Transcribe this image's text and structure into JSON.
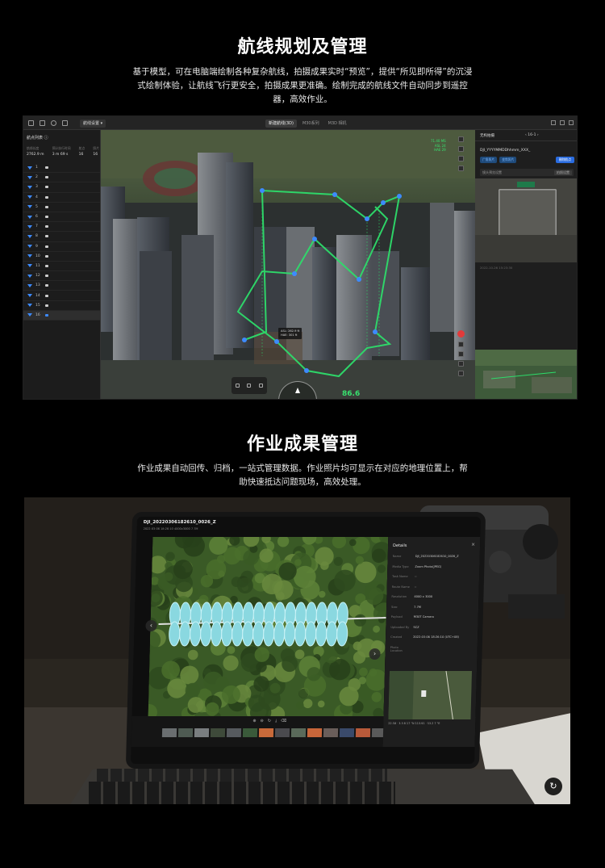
{
  "section1": {
    "title": "航线规划及管理",
    "desc_line1": "基于模型，可在电脑端绘制各种复杂航线，拍摄成果实时“预览”，提供“所见即所得”的沉浸",
    "desc_line2": "式绘制体验，让航线飞行更安全，拍摄成果更准确。绘制完成的航线文件自动同步到遥控",
    "desc_line3": "器，高效作业。"
  },
  "app": {
    "topbar": {
      "dropdown": "航线设置",
      "tabs": [
        "新建航线(3D)",
        "M30系列",
        "M3D 相机"
      ]
    },
    "left": {
      "title": "航点列表",
      "stats": [
        {
          "key": "航线长度",
          "value": "2762.9 m"
        },
        {
          "key": "预计执行时间",
          "value": "3 m 69 s"
        },
        {
          "key": "航点",
          "value": "16"
        },
        {
          "key": "照片",
          "value": "16"
        }
      ],
      "waypoints": [
        "1",
        "2",
        "3",
        "4",
        "5",
        "6",
        "7",
        "8",
        "9",
        "10",
        "11",
        "12",
        "13",
        "14",
        "15",
        "16"
      ]
    },
    "hud": {
      "alt_line1": "71.40 MS",
      "alt_line2": "ASL 24",
      "alt_line3": "HAE 29",
      "bottom_value": "86.6",
      "tooltip_line1": "ASL: 262.9 ft",
      "tooltip_line2": "HAE: 301 ft"
    },
    "right": {
      "header_left": "无构拍摄",
      "header_right": "16-1",
      "file": "DJI_YYYYMMDDhhmm_XXX_",
      "tags": [
        "广角照片",
        "变焦照片"
      ],
      "tag_button": "删除航点",
      "row_label": "镜头预览设置",
      "row_button": "拍照设置",
      "timestamp": "2022-10-26 15:23:30"
    }
  },
  "section2": {
    "title": "作业成果管理",
    "desc_line1": "作业成果自动回传、归档，一站式管理数据。作业照片均可显示在对应的地理位置上，帮",
    "desc_line2": "助快速抵达问题现场，高效处理。"
  },
  "laptop": {
    "title": "DJI_20220306182610_0026_Z",
    "subtitle": "2022-03-06 18:26:10  4000x3000  7.7M",
    "detail_title": "Details",
    "details": [
      {
        "k": "Name",
        "v": "DJI_20220306182610_0026_Z"
      },
      {
        "k": "Media Type",
        "v": "Zoom Photo(JPEG)"
      },
      {
        "k": "Task Name",
        "v": "--"
      },
      {
        "k": "Route Name",
        "v": "--"
      },
      {
        "k": "Resolution",
        "v": "4000 x 3000"
      },
      {
        "k": "Size",
        "v": "7.7M"
      },
      {
        "k": "Payload",
        "v": "M30T Camera"
      },
      {
        "k": "Uploaded By",
        "v": "SCZ"
      },
      {
        "k": "Created",
        "v": "2022-03-06 18:26:10 (UTC+08)"
      },
      {
        "k": "Photo Location",
        "v": ""
      }
    ],
    "coords": "22.58 · 3.3 8 17 °N  113.91 · 53.2 7 °E"
  },
  "colors": {
    "route": "#2ddc6a",
    "accent": "#2a6ce0",
    "hud_green": "#38e06e"
  }
}
